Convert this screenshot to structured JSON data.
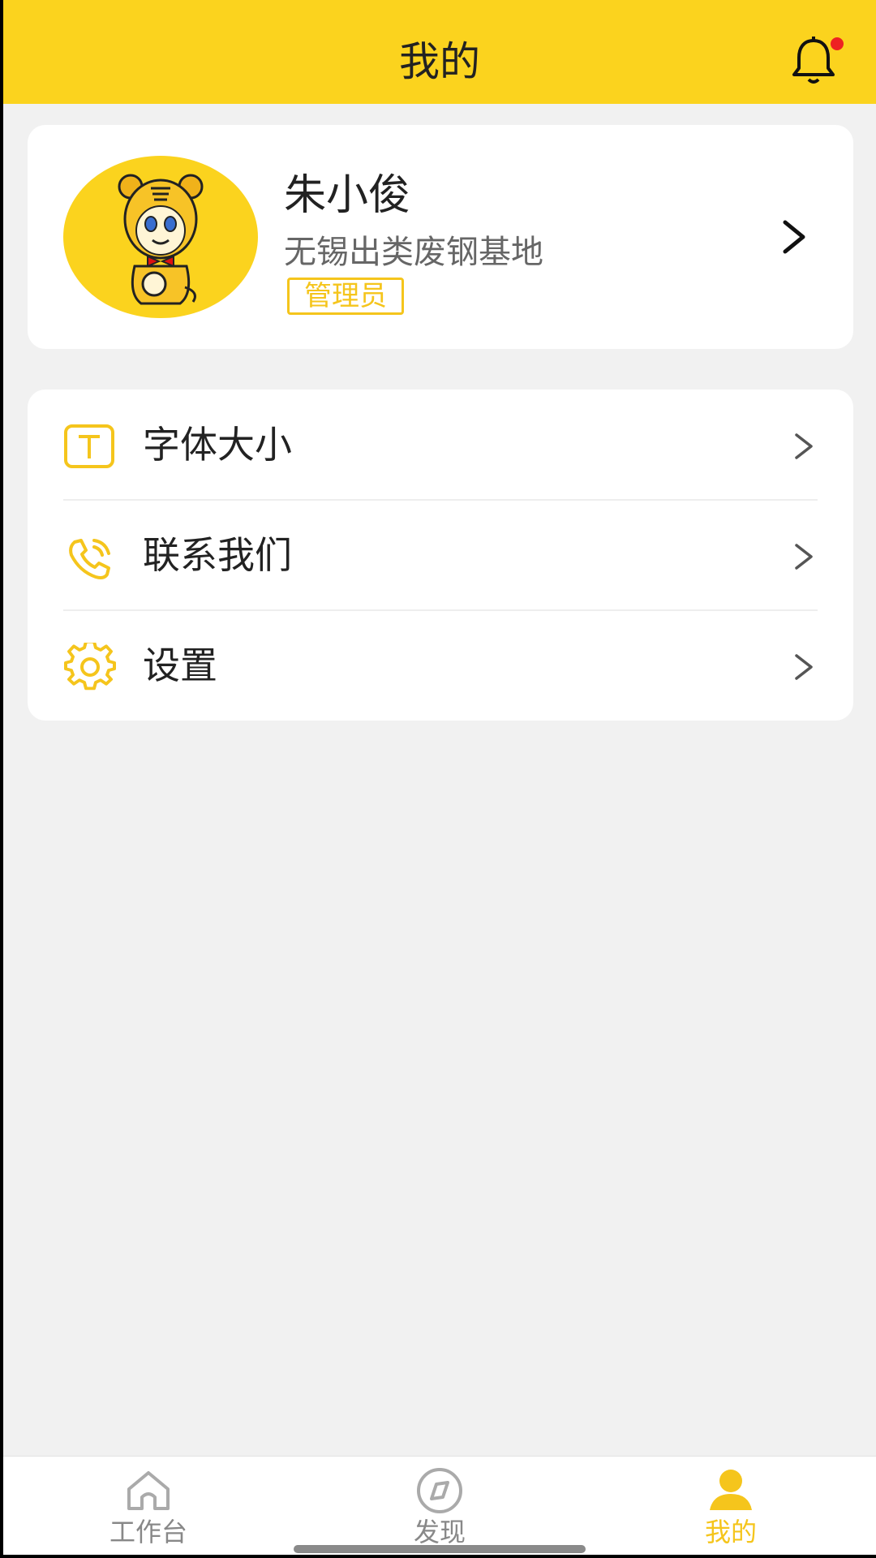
{
  "header": {
    "title": "我的"
  },
  "profile": {
    "name": "朱小俊",
    "org": "无锡出类废钢基地",
    "role": "管理员"
  },
  "menu": [
    {
      "label": "字体大小",
      "icon": "font-size-icon"
    },
    {
      "label": "联系我们",
      "icon": "phone-icon"
    },
    {
      "label": "设置",
      "icon": "gear-icon"
    }
  ],
  "tabbar": {
    "items": [
      {
        "label": "工作台",
        "icon": "home-icon"
      },
      {
        "label": "发现",
        "icon": "compass-icon"
      },
      {
        "label": "我的",
        "icon": "user-icon",
        "active": true
      }
    ]
  },
  "colors": {
    "accent": "#fbd31e",
    "badge": "#f5c51c",
    "notification_dot": "#ee2222"
  }
}
